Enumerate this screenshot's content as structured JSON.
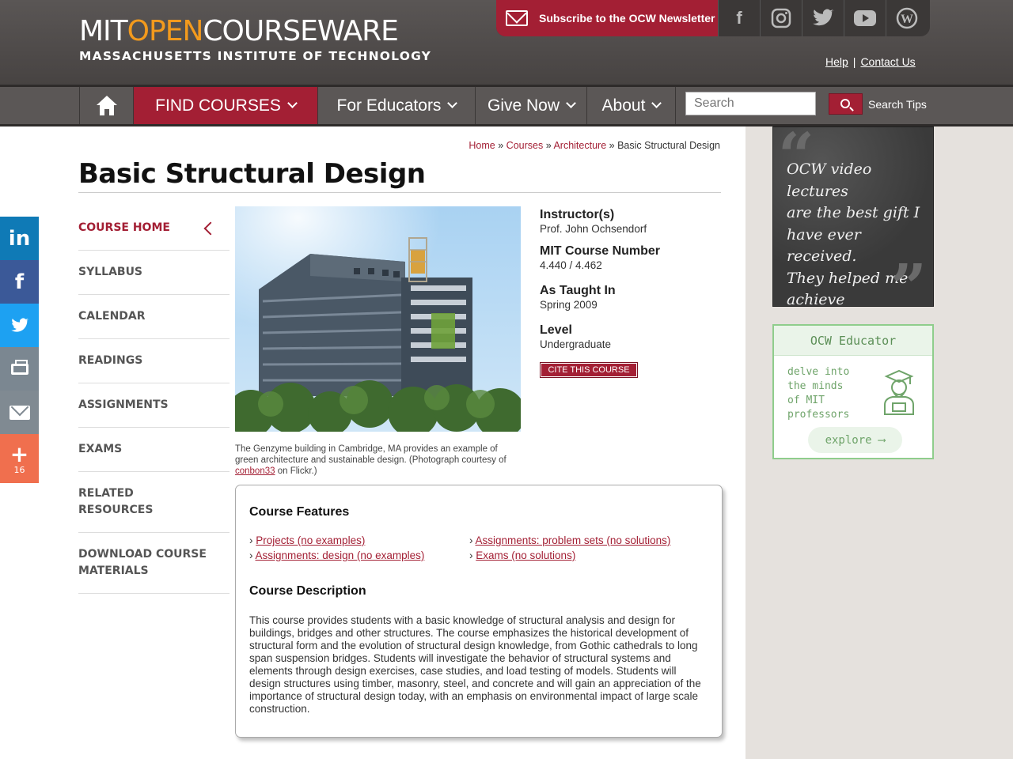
{
  "header": {
    "logo_main_1": "MIT",
    "logo_main_2": "OPEN",
    "logo_main_3": "COURSEWARE",
    "logo_sub": "MASSACHUSETTS INSTITUTE OF TECHNOLOGY",
    "subscribe_label": "Subscribe to the OCW Newsletter",
    "social": [
      "facebook-icon",
      "instagram-icon",
      "twitter-icon",
      "youtube-icon",
      "wordpress-icon"
    ],
    "help_label": "Help",
    "contact_label": "Contact Us"
  },
  "nav": {
    "find_courses": "FIND COURSES",
    "for_educators": "For Educators",
    "give_now": "Give Now",
    "about": "About",
    "search_placeholder": "Search",
    "search_tips": "Search Tips"
  },
  "breadcrumb": {
    "home": "Home",
    "sep": "»",
    "courses": "Courses",
    "architecture": "Architecture",
    "current": "Basic Structural Design"
  },
  "page_title": "Basic Structural Design",
  "side_social": {
    "share_count": "16"
  },
  "course_nav": [
    {
      "label": "COURSE HOME",
      "active": true
    },
    {
      "label": "SYLLABUS"
    },
    {
      "label": "CALENDAR"
    },
    {
      "label": "READINGS"
    },
    {
      "label": "ASSIGNMENTS"
    },
    {
      "label": "EXAMS"
    },
    {
      "label": "RELATED RESOURCES"
    },
    {
      "label": "DOWNLOAD COURSE MATERIALS"
    }
  ],
  "image": {
    "caption_text": "The Genzyme building in Cambridge, MA provides an example of green architecture and sustainable design. (Photograph courtesy of ",
    "caption_link": "conbon33",
    "caption_tail": " on Flickr.)"
  },
  "info": {
    "instructor_label": "Instructor(s)",
    "instructor_value": "Prof. John Ochsendorf",
    "number_label": "MIT Course Number",
    "number_value": "4.440 / 4.462",
    "taught_label": "As Taught In",
    "taught_value": "Spring 2009",
    "level_label": "Level",
    "level_value": "Undergraduate",
    "cite_label": "CITE THIS COURSE"
  },
  "features": {
    "heading": "Course Features",
    "items": [
      "Projects (no examples)",
      "Assignments: problem sets (no solutions)",
      "Assignments: design (no examples)",
      "Exams (no solutions)"
    ],
    "bullet": "›",
    "desc_heading": "Course Description",
    "description": "This course provides students with a basic knowledge of structural analysis and design for buildings, bridges and other structures. The course emphasizes the historical development of structural form and the evolution of structural design knowledge, from Gothic cathedrals to long span suspension bridges. Students will investigate the behavior of structural systems and elements through design exercises, case studies, and load testing of models. Students will design structures using timber, masonry, steel, and concrete and will gain an appreciation of the importance of structural design today, with an emphasis on environmental impact of large scale construction."
  },
  "quote": {
    "text": "OCW video lectures\nare the best gift I\nhave ever received.\nThey helped me achieve\nwhat I am today.\n-Faouzi"
  },
  "educator": {
    "title": "OCW Educator",
    "tagline": "delve into\nthe minds\nof MIT\nprofessors",
    "button": "explore ⟶"
  }
}
